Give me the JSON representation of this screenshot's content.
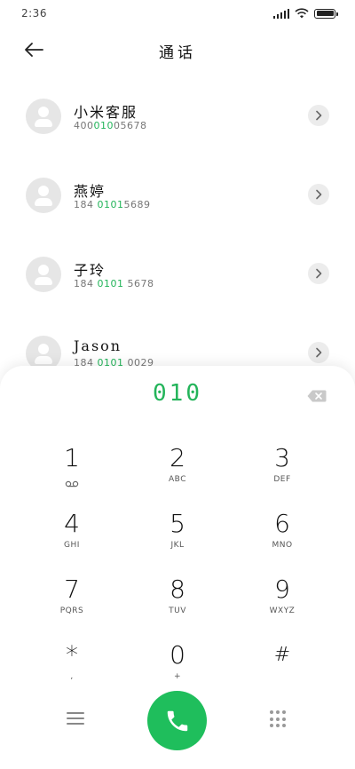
{
  "status_bar": {
    "time": "2:36",
    "icons": [
      "signal-icon",
      "wifi-icon",
      "battery-icon"
    ]
  },
  "header": {
    "title": "通话",
    "back_icon": "arrow-left-icon"
  },
  "contacts": [
    {
      "name": "小米客服",
      "number_prefix": "400",
      "number_match": "010",
      "number_suffix": "05678"
    },
    {
      "name": "燕婷",
      "number_prefix": "184 ",
      "number_match": "0101",
      "number_suffix": "5689"
    },
    {
      "name": "子玲",
      "number_prefix": "184 ",
      "number_match": "0101",
      "number_suffix": " 5678"
    },
    {
      "name": "Jason",
      "number_prefix": "184 ",
      "number_match": "0101",
      "number_suffix": " 0029"
    }
  ],
  "dialpad": {
    "input_value": "010",
    "keys": [
      {
        "digit": "1",
        "letters": "",
        "sub_icon": "voicemail-icon"
      },
      {
        "digit": "2",
        "letters": "ABC"
      },
      {
        "digit": "3",
        "letters": "DEF"
      },
      {
        "digit": "4",
        "letters": "GHI"
      },
      {
        "digit": "5",
        "letters": "JKL"
      },
      {
        "digit": "6",
        "letters": "MNO"
      },
      {
        "digit": "7",
        "letters": "PQRS"
      },
      {
        "digit": "8",
        "letters": "TUV"
      },
      {
        "digit": "9",
        "letters": "WXYZ"
      },
      {
        "digit": "*",
        "letters": ","
      },
      {
        "digit": "0",
        "letters": "+"
      },
      {
        "digit": "#",
        "letters": ""
      }
    ],
    "delete_icon": "backspace-icon"
  },
  "bottom_bar": {
    "menu_icon": "menu-icon",
    "call_icon": "phone-icon",
    "keypad_icon": "dialpad-grid-icon"
  },
  "colors": {
    "accent_green": "#23b45a",
    "call_button": "#1fbe5c",
    "avatar_bg": "#e6e6e6"
  }
}
